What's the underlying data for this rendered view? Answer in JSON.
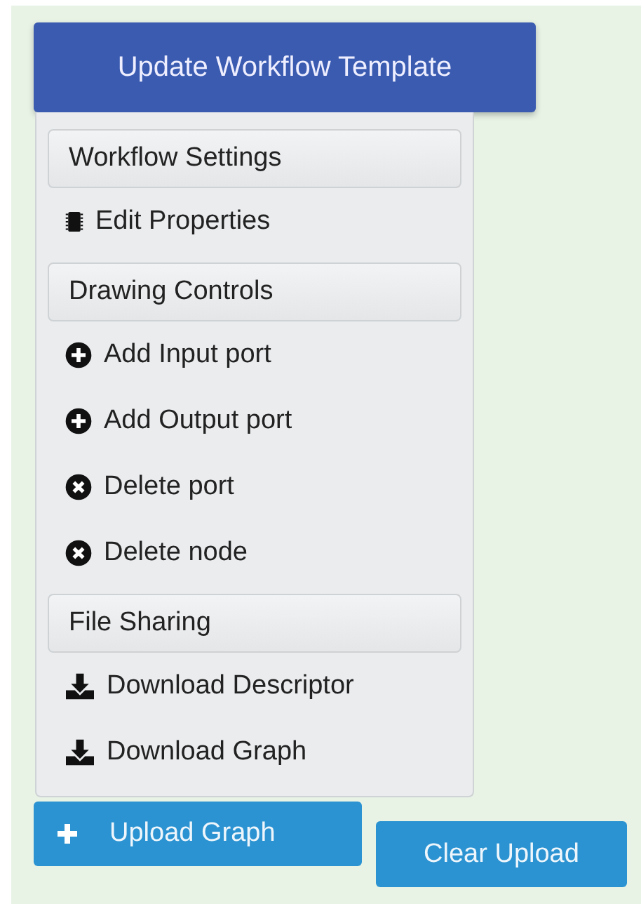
{
  "primary_button": {
    "label": "Update Workflow Template"
  },
  "menu": [
    {
      "kind": "header",
      "label": "Workflow Settings"
    },
    {
      "kind": "properties",
      "label": "Edit Properties"
    },
    {
      "kind": "header",
      "label": "Drawing Controls"
    },
    {
      "kind": "add",
      "label": "Add Input port"
    },
    {
      "kind": "add",
      "label": "Add Output port"
    },
    {
      "kind": "delete",
      "label": "Delete port"
    },
    {
      "kind": "delete",
      "label": "Delete node"
    },
    {
      "kind": "header",
      "label": "File Sharing"
    },
    {
      "kind": "download",
      "label": "Download Descriptor"
    },
    {
      "kind": "download",
      "label": "Download Graph"
    }
  ],
  "upload_button": {
    "label": "Upload Graph"
  },
  "clear_button": {
    "label": "Clear Upload"
  }
}
